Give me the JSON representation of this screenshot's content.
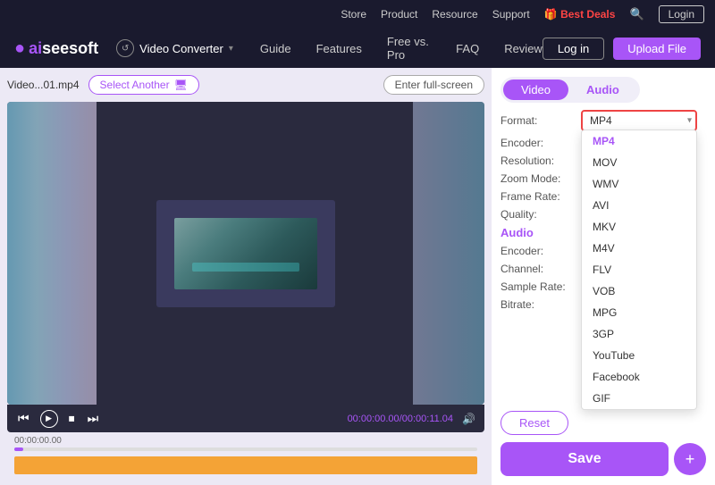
{
  "topnav": {
    "links": [
      "Store",
      "Product",
      "Resource",
      "Support"
    ],
    "best_deals": "Best Deals",
    "login_label": "Login"
  },
  "mainnav": {
    "logo_ai": "ai",
    "logo_rest": "seesoft",
    "app_name": "Video Converter",
    "links": [
      "Guide",
      "Features",
      "Free vs. Pro",
      "FAQ",
      "Review"
    ],
    "login_label": "Log in",
    "upload_label": "Upload File"
  },
  "file_bar": {
    "file_name": "Video...01.mp4",
    "select_another": "Select Another",
    "full_screen": "Enter full-screen"
  },
  "controls": {
    "time_current": "00:00:00.00",
    "time_total": "00:00:11.04"
  },
  "tabs": {
    "video_label": "Video",
    "audio_label": "Audio"
  },
  "settings": {
    "format_label": "Format:",
    "encoder_label": "Encoder:",
    "resolution_label": "Resolution:",
    "zoom_label": "Zoom Mode:",
    "frame_label": "Frame Rate:",
    "quality_label": "Quality:",
    "audio_label": "Audio",
    "enc2_label": "Encoder:",
    "channel_label": "Channel:",
    "sample_label": "Sample Rate:",
    "bitrate_label": "Bitrate:",
    "format_value": "MP4"
  },
  "dropdown": {
    "items": [
      "MP4",
      "MOV",
      "WMV",
      "AVI",
      "MKV",
      "M4V",
      "FLV",
      "VOB",
      "MPG",
      "3GP",
      "YouTube",
      "Facebook",
      "GIF"
    ],
    "selected": "MP4"
  },
  "buttons": {
    "reset": "Reset",
    "save": "Save",
    "plus": "+"
  },
  "icons": {
    "search": "🔍",
    "chevron_down": "▾",
    "play": "▶",
    "rewind": "⏮",
    "fast_forward": "⏭",
    "stop": "⏹",
    "volume": "🔊",
    "monitor": "🖥"
  }
}
